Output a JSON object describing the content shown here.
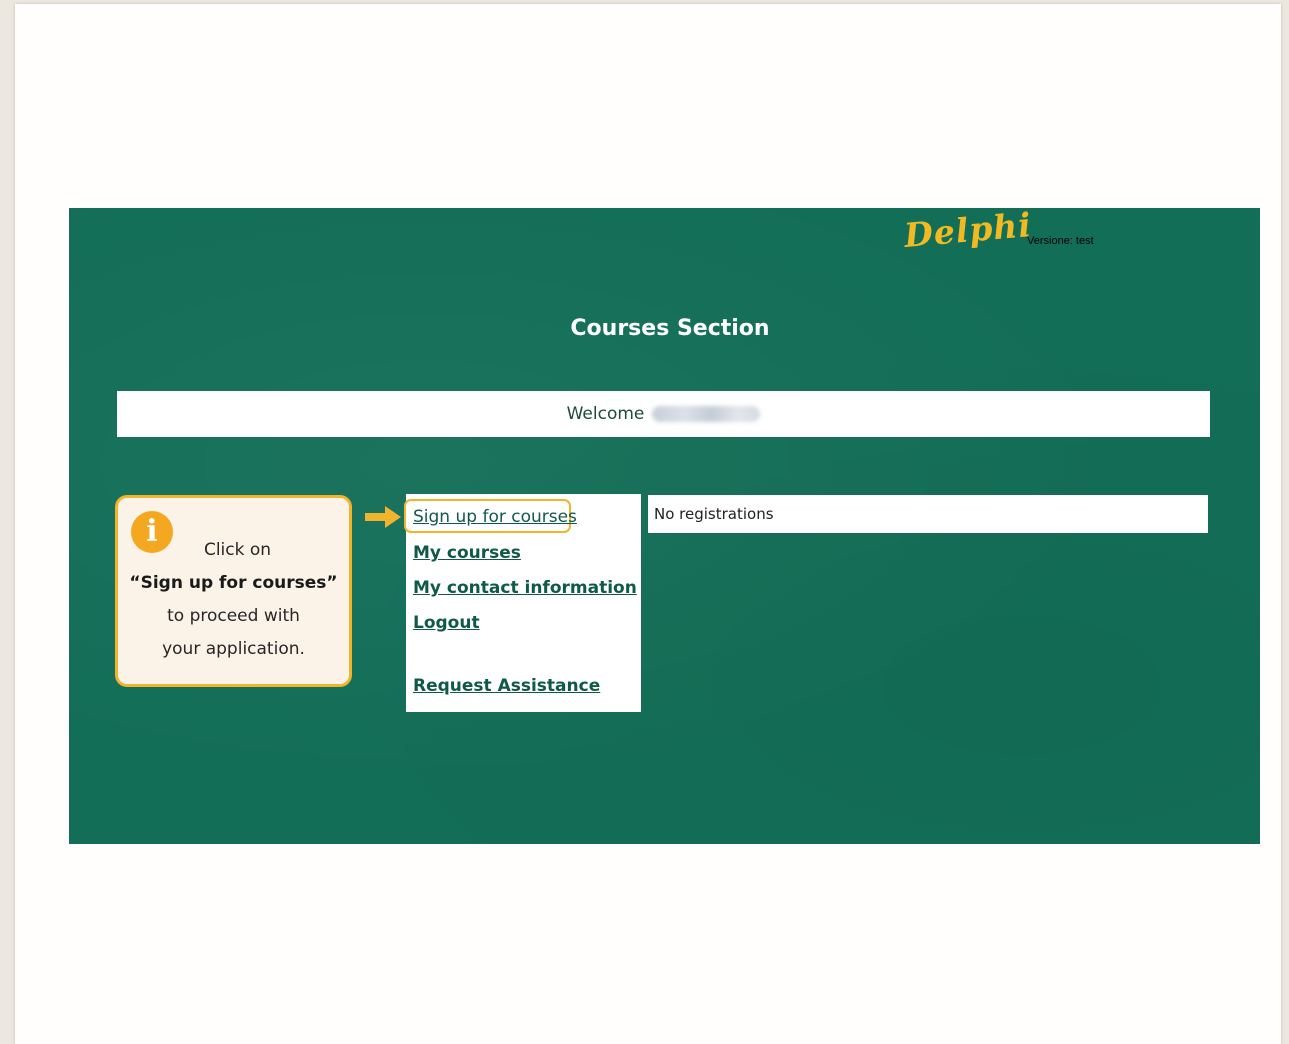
{
  "header": {
    "logo_text": "Delphi",
    "version_text": "Versione: test"
  },
  "main": {
    "section_title": "Courses Section",
    "welcome_label": "Welcome"
  },
  "menu": {
    "items": [
      {
        "label": "Sign up for courses"
      },
      {
        "label": "My courses"
      },
      {
        "label": "My contact information"
      },
      {
        "label": "Logout"
      },
      {
        "label": "Request Assistance"
      }
    ]
  },
  "registrations": {
    "status_text": "No registrations"
  },
  "tip": {
    "icon": "info-icon",
    "line1": "Click on",
    "line2": "“Sign up for courses”",
    "line3": "to proceed with",
    "line4": "your application."
  },
  "colors": {
    "app_background": "#136e57",
    "accent": "#f3b42d",
    "logo": "#f1ba22"
  }
}
